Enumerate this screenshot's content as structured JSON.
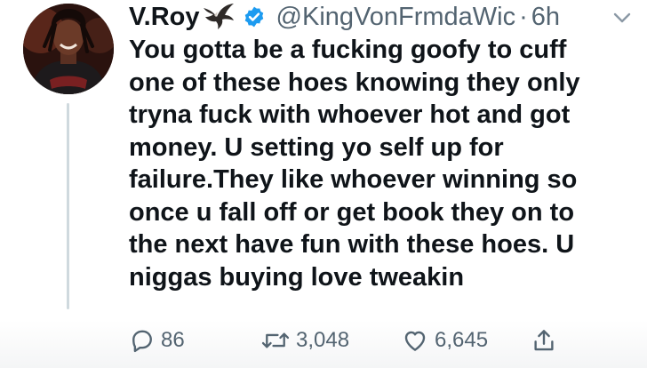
{
  "tweet": {
    "display_name": "V.Roy",
    "handle": "@KingVonFrmdaWic",
    "separator": "·",
    "time": "6h",
    "text": "You gotta be a fucking goofy to cuff\none of these hoes knowing they only\ntryna fuck with whoever hot and got\nmoney. U setting yo self up for\nfailure.They like whoever winning so\nonce u fall off or get book they on to\nthe next have fun with these hoes. U\nniggas buying love tweakin",
    "badges": [
      "hawk-emoji-icon",
      "verified-badge-icon"
    ]
  },
  "actions": {
    "reply_count": "86",
    "retweet_count": "3,048",
    "like_count": "6,645"
  },
  "colors": {
    "text": "#0f1419",
    "secondary": "#536471",
    "verified": "#1d9bf0",
    "thread_line": "#cfd9de"
  }
}
